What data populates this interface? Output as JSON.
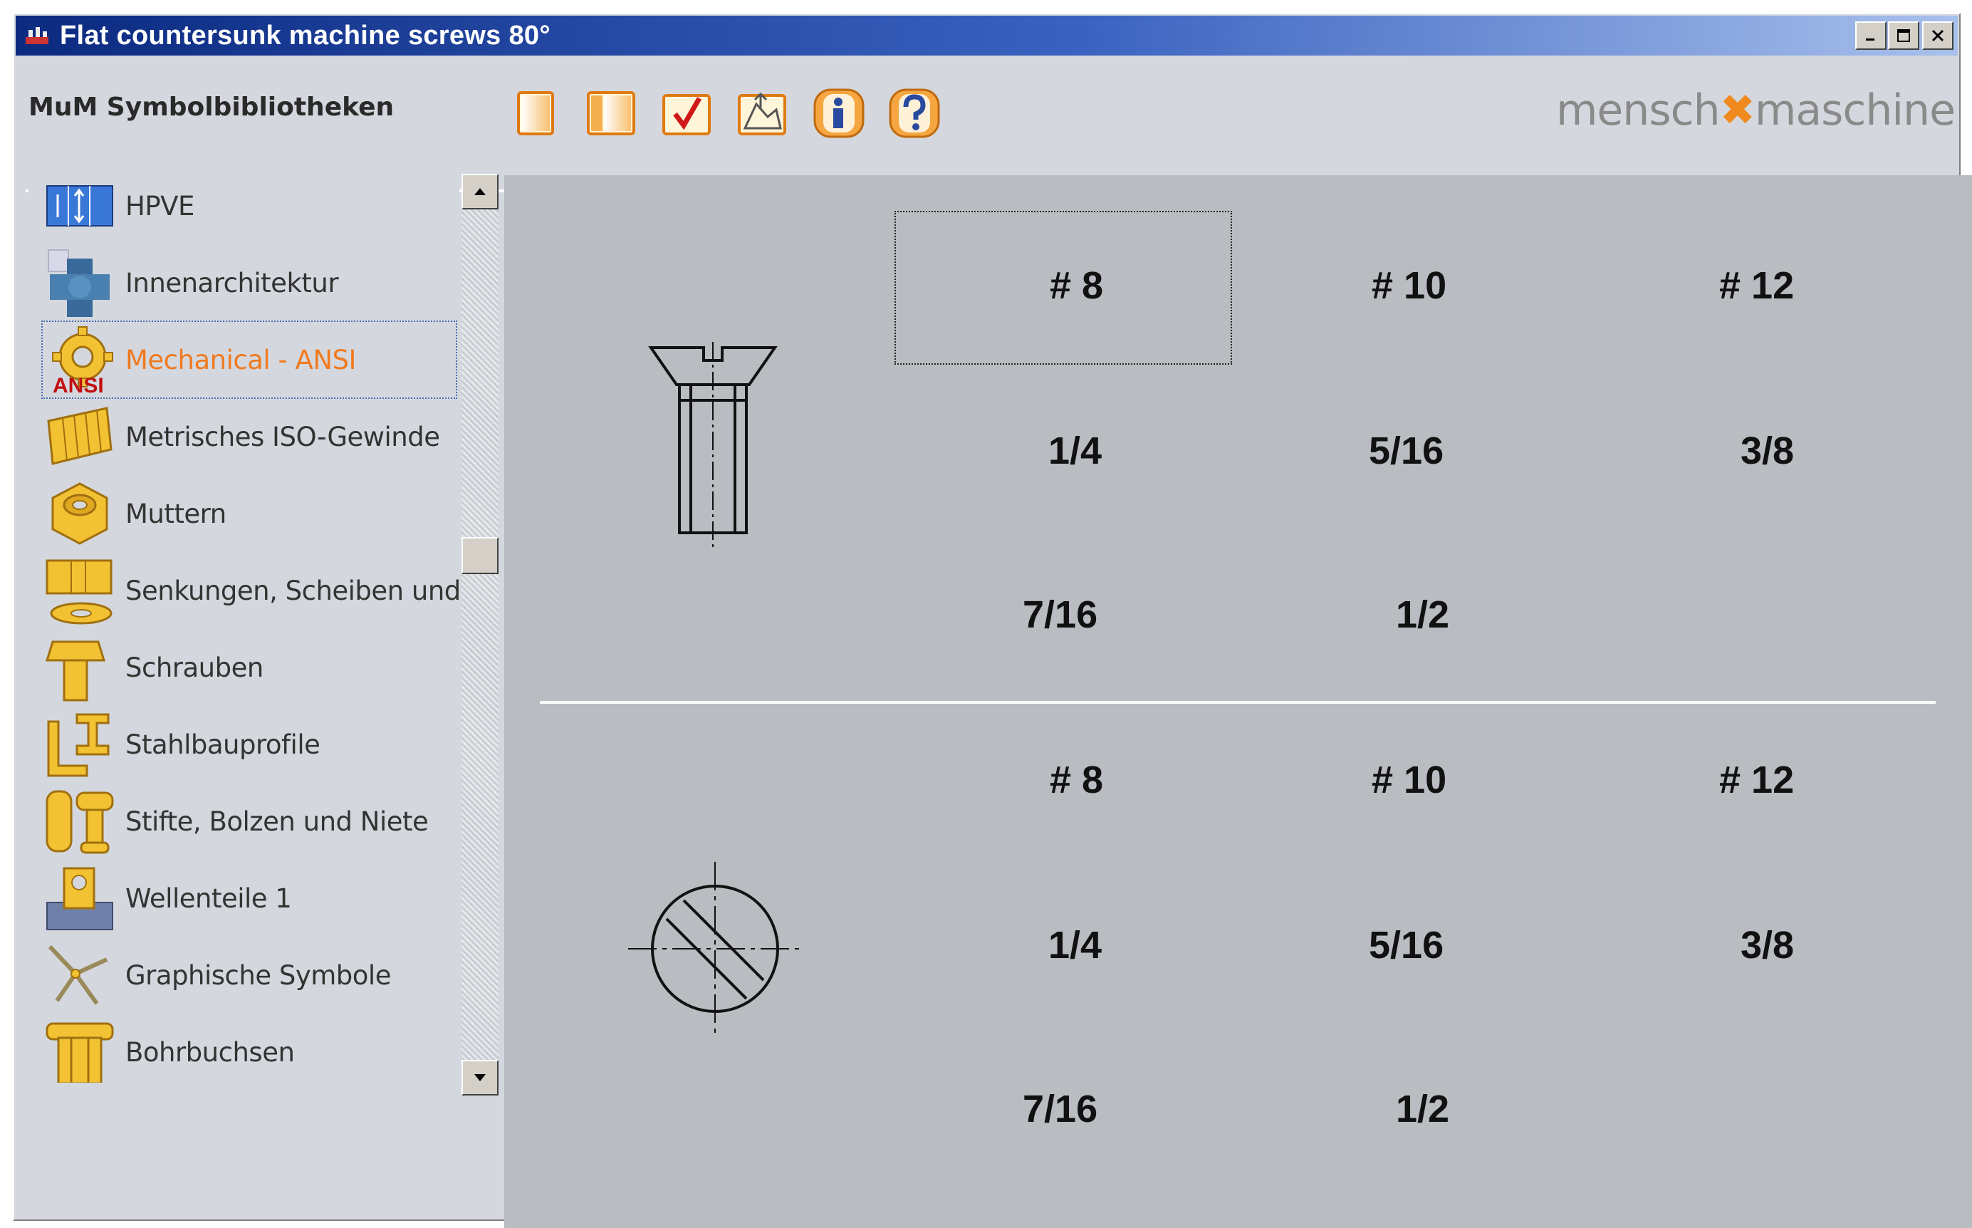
{
  "window": {
    "title": "Flat countersunk machine screws 80°"
  },
  "toolbar": {
    "app_label": "MuM Symbolbibliotheken",
    "brand_left": "mensch",
    "brand_mark": "✖",
    "brand_right": "maschine",
    "buttons": [
      {
        "icon": "blank-page-icon"
      },
      {
        "icon": "panel-page-icon"
      },
      {
        "icon": "checkmark-icon"
      },
      {
        "icon": "insert-symbol-icon"
      },
      {
        "icon": "info-icon"
      },
      {
        "icon": "help-icon"
      }
    ]
  },
  "sidebar": {
    "items": [
      {
        "label": "HPVE",
        "icon": "hpve-icon"
      },
      {
        "label": "Innenarchitektur",
        "icon": "innenarchitektur-icon"
      },
      {
        "label": "Mechanical - ANSI",
        "icon": "mechanical-ansi-icon",
        "badge": "ANSI",
        "selected": true
      },
      {
        "label": "Metrisches ISO-Gewinde",
        "icon": "iso-thread-icon"
      },
      {
        "label": "Muttern",
        "icon": "nut-icon"
      },
      {
        "label": "Senkungen, Scheiben und Du",
        "icon": "washer-icon"
      },
      {
        "label": "Schrauben",
        "icon": "screw-icon"
      },
      {
        "label": "Stahlbauprofile",
        "icon": "steel-profile-icon"
      },
      {
        "label": "Stifte, Bolzen und Niete",
        "icon": "pin-bolt-icon"
      },
      {
        "label": "Wellenteile 1",
        "icon": "shaft-part-icon"
      },
      {
        "label": "Graphische Symbole",
        "icon": "graphic-symbol-icon"
      },
      {
        "label": "Bohrbuchsen",
        "icon": "drill-bushing-icon"
      }
    ]
  },
  "content": {
    "side_view": {
      "sizes": [
        [
          "# 8",
          "# 10",
          "# 12"
        ],
        [
          "1/4",
          "5/16",
          "3/8"
        ],
        [
          "7/16",
          "1/2"
        ]
      ]
    },
    "top_view": {
      "sizes": [
        [
          "# 8",
          "# 10",
          "# 12"
        ],
        [
          "1/4",
          "5/16",
          "3/8"
        ],
        [
          "7/16",
          "1/2"
        ]
      ]
    }
  },
  "colors": {
    "title_gradient_start": "#0b2a80",
    "title_gradient_end": "#a8c0ec",
    "accent_orange": "#f07a20",
    "icon_yellow": "#f2c233",
    "content_background": "#b9bcc1"
  }
}
